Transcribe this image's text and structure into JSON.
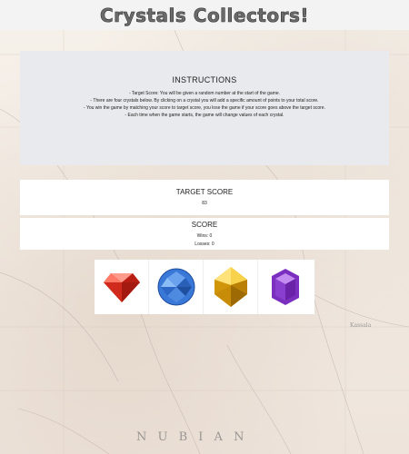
{
  "header": {
    "title": "Crystals Collectors!"
  },
  "instructions": {
    "heading": "INSTRUCTIONS",
    "lines": [
      "- Target Score: You will be given a random number at the start of the game.",
      "- There are four crystals below. By clicking on a crystal you will add a specific amount of points to your total score.",
      "- You win the game by matching your score to target score, you lose the game if your score goes above the target score.",
      "- Each time when the game starts, the game will change values of each crystal."
    ]
  },
  "target": {
    "label": "TARGET SCORE",
    "value": "83"
  },
  "score": {
    "label": "SCORE",
    "wins": "Wins: 0",
    "losses": "Losses: 0"
  },
  "crystals": [
    {
      "name": "red-crystal-icon",
      "color": "#e53b2c"
    },
    {
      "name": "blue-crystal-icon",
      "color": "#3a78d8"
    },
    {
      "name": "yellow-crystal-icon",
      "color": "#e3a813"
    },
    {
      "name": "purple-crystal-icon",
      "color": "#7b2fbf"
    }
  ],
  "map_labels": {
    "bottom": "N U B I A N",
    "right": "Kassala"
  }
}
